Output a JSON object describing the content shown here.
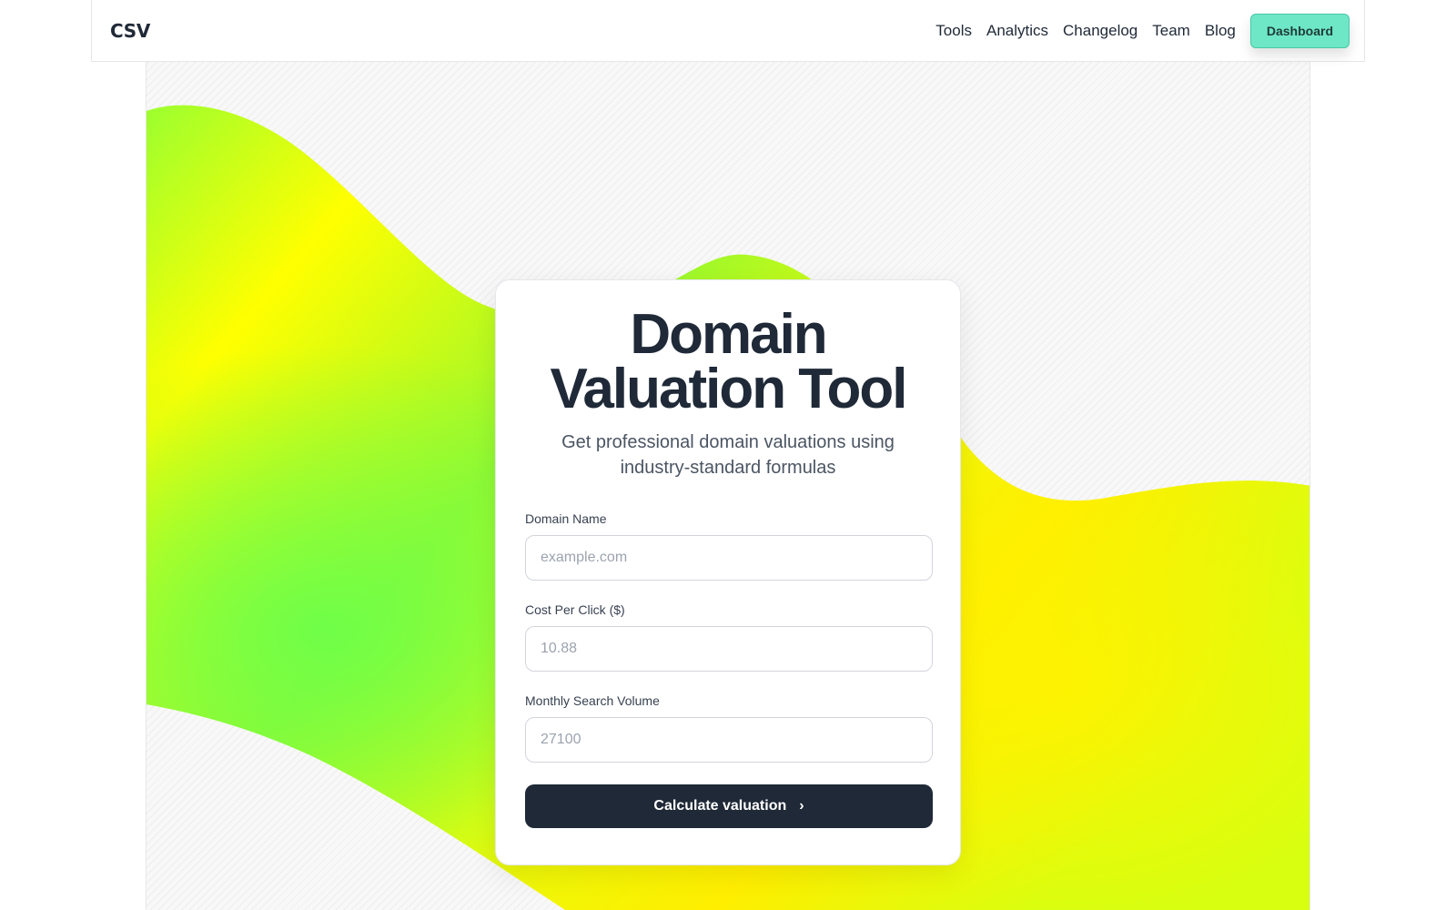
{
  "nav": {
    "brand": "CSV",
    "links": [
      "Tools",
      "Analytics",
      "Changelog",
      "Team",
      "Blog"
    ],
    "cta_label": "Dashboard",
    "cta_color": "#6ee7c7"
  },
  "hero": {
    "title_line1": "Domain",
    "title_line2": "Valuation Tool",
    "subtitle": "Get professional domain valuations using industry-standard formulas",
    "gradient_colors": [
      "#7dfa3a",
      "#ffff00",
      "#ffe800"
    ]
  },
  "form": {
    "domain": {
      "label": "Domain Name",
      "placeholder": "example.com"
    },
    "cpc": {
      "label": "Cost Per Click ($)",
      "placeholder": "10.88"
    },
    "volume": {
      "label": "Monthly Search Volume",
      "placeholder": "27100"
    },
    "submit_label": "Calculate valuation",
    "submit_icon": "chevron-right-icon"
  }
}
